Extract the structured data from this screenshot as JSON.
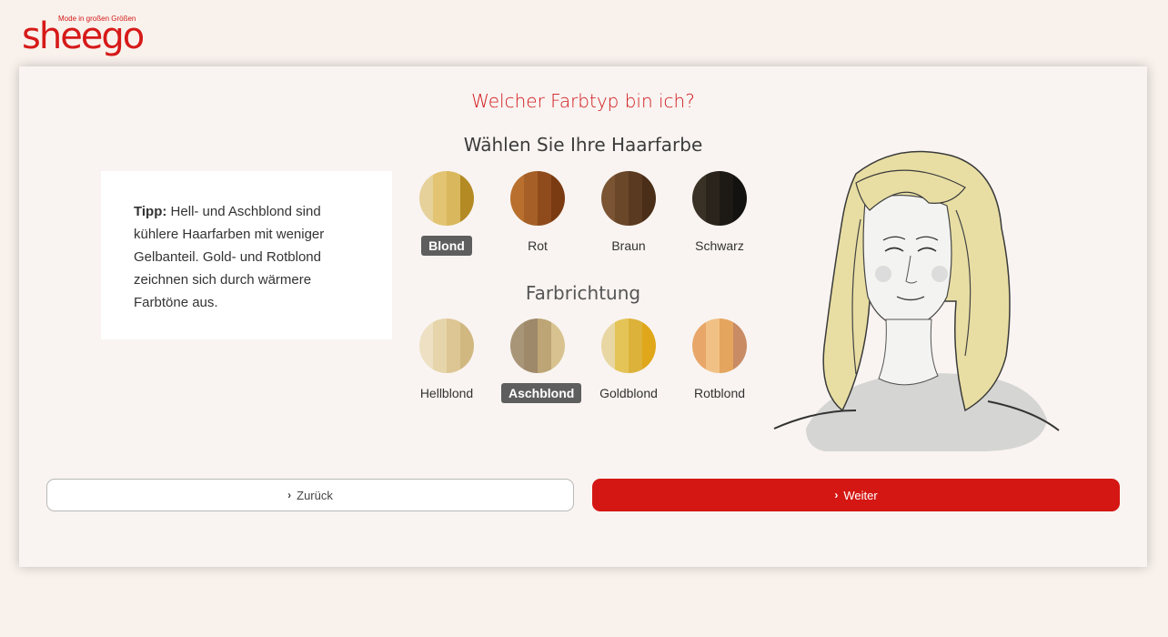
{
  "brand": {
    "logo_text": "sheego",
    "tagline": "Mode in großen Größen",
    "color": "#d61a1a"
  },
  "quiz": {
    "title": "Welcher Farbtyp bin ich?",
    "tip_label": "Tipp:",
    "tip_text": " Hell- und Aschblond sind kühlere Haarfarben mit weniger Gelbanteil. Gold- und Rotblond zeichnen sich durch wärmere Farbtöne aus."
  },
  "hair": {
    "heading": "Wählen Sie Ihre Haarfarbe",
    "selected": "Blond",
    "options": [
      {
        "label": "Blond",
        "colors": [
          "#e7d19a",
          "#e3c473",
          "#d9b75c",
          "#b48a25"
        ]
      },
      {
        "label": "Rot",
        "colors": [
          "#b9702f",
          "#a65f26",
          "#8f4b1b",
          "#7a3a12"
        ]
      },
      {
        "label": "Braun",
        "colors": [
          "#7b5434",
          "#6b4729",
          "#5a3a20",
          "#4a2e18"
        ]
      },
      {
        "label": "Schwarz",
        "colors": [
          "#3a3126",
          "#2a241d",
          "#1d1a16",
          "#141210"
        ]
      }
    ]
  },
  "direction": {
    "heading": "Farbrichtung",
    "selected": "Aschblond",
    "options": [
      {
        "label": "Hellblond",
        "colors": [
          "#eee1c3",
          "#e6d4aa",
          "#ddc693",
          "#d1b881"
        ]
      },
      {
        "label": "Aschblond",
        "colors": [
          "#a89577",
          "#9e8a6a",
          "#bda575",
          "#d8c390"
        ]
      },
      {
        "label": "Goldblond",
        "colors": [
          "#e8d7a3",
          "#e4c457",
          "#dcb23b",
          "#e0a71a"
        ]
      },
      {
        "label": "Rotblond",
        "colors": [
          "#e8a769",
          "#f0c085",
          "#e4a55f",
          "#c88b63"
        ]
      }
    ]
  },
  "buttons": {
    "back_label": "Zurück",
    "next_label": "Weiter",
    "next_color": "#d51714"
  }
}
